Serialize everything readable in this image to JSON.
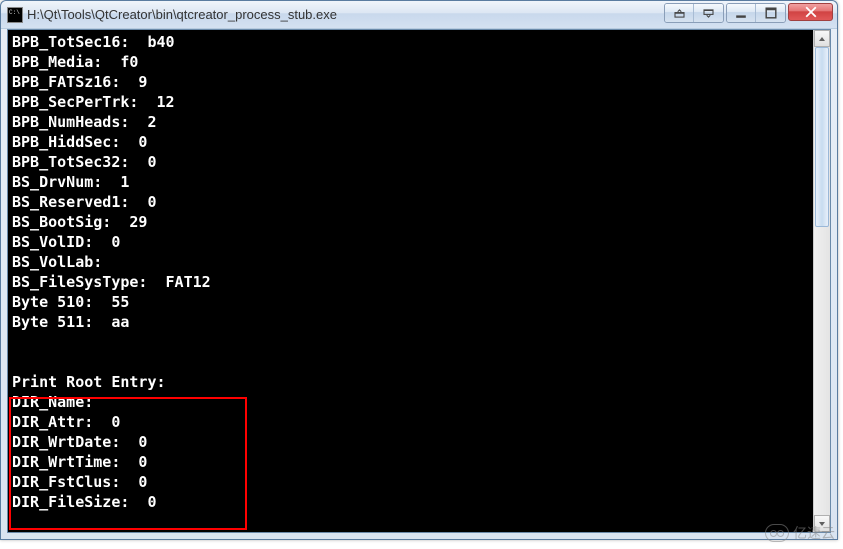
{
  "window": {
    "title": "H:\\Qt\\Tools\\QtCreator\\bin\\qtcreator_process_stub.exe"
  },
  "console": {
    "lines": [
      "BPB_TotSec16:  b40",
      "BPB_Media:  f0",
      "BPB_FATSz16:  9",
      "BPB_SecPerTrk:  12",
      "BPB_NumHeads:  2",
      "BPB_HiddSec:  0",
      "BPB_TotSec32:  0",
      "BS_DrvNum:  1",
      "BS_Reserved1:  0",
      "BS_BootSig:  29",
      "BS_VolID:  0",
      "BS_VolLab:",
      "BS_FileSysType:  FAT12",
      "Byte 510:  55",
      "Byte 511:  aa",
      "",
      "",
      "Print Root Entry:",
      "DIR_Name:",
      "DIR_Attr:  0",
      "DIR_WrtDate:  0",
      "DIR_WrtTime:  0",
      "DIR_FstClus:  0",
      "DIR_FileSize:  0"
    ]
  },
  "watermark": {
    "text": "亿速云"
  }
}
